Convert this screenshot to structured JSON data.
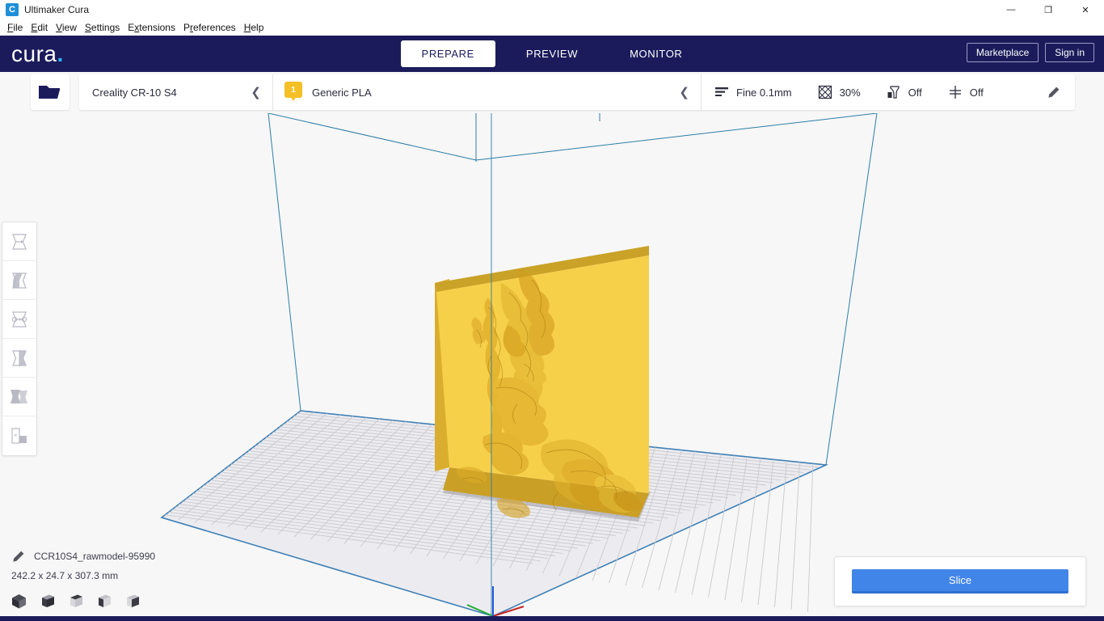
{
  "window": {
    "title": "Ultimaker Cura",
    "app_icon": "cura-logo-icon",
    "minimize": "—",
    "maximize": "❐",
    "close": "✕"
  },
  "menubar": {
    "items": [
      {
        "name": "file",
        "pre": "",
        "key": "F",
        "post": "ile"
      },
      {
        "name": "edit",
        "pre": "",
        "key": "E",
        "post": "dit"
      },
      {
        "name": "view",
        "pre": "",
        "key": "V",
        "post": "iew"
      },
      {
        "name": "settings",
        "pre": "",
        "key": "S",
        "post": "ettings"
      },
      {
        "name": "extensions",
        "pre": "E",
        "key": "x",
        "post": "tensions"
      },
      {
        "name": "preferences",
        "pre": "P",
        "key": "r",
        "post": "eferences"
      },
      {
        "name": "help",
        "pre": "",
        "key": "H",
        "post": "elp"
      }
    ]
  },
  "header": {
    "logo_text": "cura",
    "logo_dot": ".",
    "tabs": [
      {
        "label": "PREPARE",
        "active": true
      },
      {
        "label": "PREVIEW",
        "active": false
      },
      {
        "label": "MONITOR",
        "active": false
      }
    ],
    "marketplace_label": "Marketplace",
    "signin_label": "Sign in",
    "background_color": "#1b1b5c",
    "accent_color": "#29b6f6"
  },
  "toolbar": {
    "open_file_icon": "open-folder-icon",
    "printer": {
      "name": "Creality CR-10 S4",
      "collapse_icon": "chevron-left-icon"
    },
    "material": {
      "extruder_number": "1",
      "name": "Generic PLA",
      "collapse_icon": "chevron-left-icon",
      "badge_color": "#f4c025"
    },
    "print_settings": [
      {
        "name": "layer-height",
        "icon": "layer-height-icon",
        "value": "Fine 0.1mm"
      },
      {
        "name": "infill",
        "icon": "infill-icon",
        "value": "30%"
      },
      {
        "name": "support",
        "icon": "support-icon",
        "value": "Off"
      },
      {
        "name": "adhesion",
        "icon": "adhesion-icon",
        "value": "Off"
      }
    ],
    "edit_icon": "pencil-icon"
  },
  "tools": [
    {
      "name": "move-tool",
      "icon": "move-tool-icon"
    },
    {
      "name": "scale-tool",
      "icon": "scale-tool-icon"
    },
    {
      "name": "rotate-tool",
      "icon": "rotate-tool-icon"
    },
    {
      "name": "mirror-tool",
      "icon": "mirror-tool-icon"
    },
    {
      "name": "per-model-settings",
      "icon": "per-model-settings-icon"
    },
    {
      "name": "support-blocker",
      "icon": "support-blocker-icon"
    }
  ],
  "viewport": {
    "background_color": "#f7f7f7",
    "buildplate_grid_color": "#c9c9cf",
    "buildplate_outline_color": "#3d7fb5",
    "volume_outline_color": "#2c7ea8",
    "model_color": "#f7d04a",
    "model_shade_color": "#e8be38",
    "axis_x_color": "#cc2222",
    "axis_y_color": "#22aa33",
    "axis_z_color": "#2255dd"
  },
  "model": {
    "edit_icon": "pencil-icon",
    "name": "CCR10S4_rawmodel-95990",
    "dimensions": "242.2 x 24.7 x 307.3 mm"
  },
  "view_buttons": [
    {
      "name": "view-3d",
      "icon": "cube-3d-icon"
    },
    {
      "name": "view-front",
      "icon": "cube-front-icon"
    },
    {
      "name": "view-top",
      "icon": "cube-top-icon"
    },
    {
      "name": "view-left",
      "icon": "cube-left-icon"
    },
    {
      "name": "view-right",
      "icon": "cube-right-icon"
    }
  ],
  "action_panel": {
    "slice_label": "Slice",
    "slice_color": "#4285e8"
  }
}
